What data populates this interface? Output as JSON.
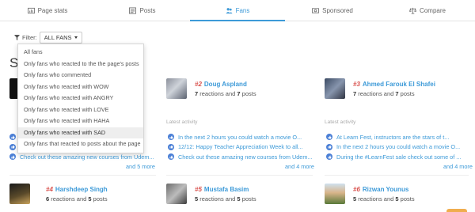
{
  "tabs": [
    {
      "label": "Page stats",
      "icon": "chart-icon"
    },
    {
      "label": "Posts",
      "icon": "posts-icon"
    },
    {
      "label": "Fans",
      "icon": "users-icon",
      "active": true
    },
    {
      "label": "Sponsored",
      "icon": "money-icon"
    },
    {
      "label": "Compare",
      "icon": "scales-icon"
    }
  ],
  "filter": {
    "label": "Filter:",
    "selected": "ALL FANS"
  },
  "section_letter": "S",
  "dropdown": {
    "options": [
      "All fans",
      "Only fans who reacted to the the page's posts",
      "Only fans who commented",
      "Only fans who reacted with WOW",
      "Only fans who reacted with ANGRY",
      "Only fans who reacted with LOVE",
      "Only fans who reacted with HAHA",
      "Only fans who reacted with SAD",
      "Only fans that reacted to posts about the page"
    ],
    "highlighted_index": 7
  },
  "latest_activity_label": "Latest activity",
  "fans": [
    {
      "rank": "#2",
      "name": "Doug Aspland",
      "reactions": "7",
      "posts": "7",
      "reactions_word": "reactions and",
      "posts_word": "posts"
    },
    {
      "rank": "#3",
      "name": "Ahmed Farouk El Shafei",
      "reactions": "7",
      "posts": "7",
      "reactions_word": "reactions and",
      "posts_word": "posts"
    },
    {
      "rank": "#4",
      "name": "Harshdeep Singh",
      "reactions": "6",
      "posts": "5",
      "reactions_word": "reactions and",
      "posts_word": "posts"
    },
    {
      "rank": "#5",
      "name": "Mustafa Basim",
      "reactions": "5",
      "posts": "5",
      "reactions_word": "reactions and",
      "posts_word": "posts"
    },
    {
      "rank": "#6",
      "name": "Rizwan Younus",
      "reactions": "5",
      "posts": "5",
      "reactions_word": "reactions and",
      "posts_word": "posts"
    }
  ],
  "activity_columns": [
    {
      "items": [
        "",
        "",
        "Check out these amazing new courses from Udem..."
      ],
      "more": "and 5 more"
    },
    {
      "items": [
        "In the next 2 hours you could watch a movie O...",
        "12/12: Happy Teacher Appreciation Week to all...",
        "Check out these amazing new courses from Udem..."
      ],
      "more": "and 4 more"
    },
    {
      "items": [
        "At Learn Fest, instructors are the stars of t...",
        "In the next 2 hours you could watch a movie O...",
        "During the #LearnFest sale check out some of ..."
      ],
      "more": "and 4 more"
    }
  ],
  "colors": {
    "accent": "#3d9ad8",
    "rank": "#d9534f",
    "like": "#4a7fd6"
  }
}
